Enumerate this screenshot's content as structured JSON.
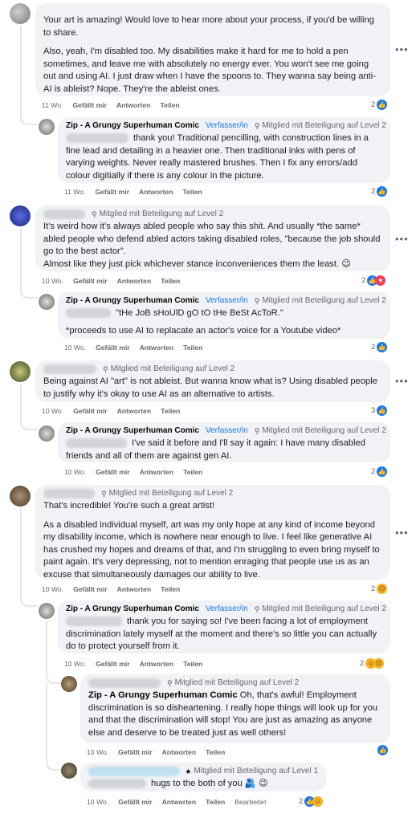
{
  "labels": {
    "like": "Gefällt mir",
    "reply": "Antworten",
    "share": "Teilen",
    "edited": "Bearbeitet",
    "author_tag": "Verfasser/in",
    "badge_level2": "Mitglied mit Beteiligung auf Level 2",
    "badge_level1": "Mitglied mit Beteiligung auf Level 1",
    "more": "•••"
  },
  "colors": {
    "accent": "#1877f2",
    "bubble": "#f0f2f5",
    "muted": "#65676b"
  },
  "comments": [
    {
      "author": "Zip - A Grungy Superhuman Comic",
      "texts": [
        "Your art is amazing! Would love to hear more about your process, if you'd be willing to share.",
        "Also, yeah, I'm disabled too. My disabilities make it hard for me to hold a pen sometimes, and leave me with absolutely no energy ever. You won't see me going out and using AI. I just draw when I have the spoons to. They wanna say being anti-AI is ableist? Nope. They're the ableist ones."
      ],
      "time": "11 Wo.",
      "reactions": "2"
    },
    {
      "author": "Zip - A Grungy Superhuman Comic",
      "text": "thank you! Traditional pencilling, with construction lines in a fine lead and detailing in a heavier one. Then traditional inks with pens of varying weights. Never really mastered brushes. Then I fix any errors/add colour digitially if there is any colour in the picture.",
      "time": "11 Wo.",
      "reactions": "2"
    },
    {
      "text": "It's weird how it's always abled people who say this shit. And usually *the same* abled people who defend abled actors taking disabled roles, \"because the job should go to the best actor\".\nAlmost like they just pick whichever stance inconveniences them the least. 😉",
      "time": "10 Wo.",
      "reactions": "2"
    },
    {
      "author": "Zip - A Grungy Superhuman Comic",
      "text1": "\"tHe JoB sHoUlD gO tO tHe BeSt AcToR.\"",
      "text2": "*proceeds to use AI to replacate an actor's voice for a Youtube video*",
      "time": "10 Wo.",
      "reactions": "2"
    },
    {
      "text": "Being against AI \"art\" is not ableist. But wanna know what is? Using disabled people to justify why it's okay to use AI as an alternative to artists.",
      "time": "10 Wo.",
      "reactions": "3"
    },
    {
      "author": "Zip - A Grungy Superhuman Comic",
      "text": "I've said it before and I'll say it again: I have many disabled friends and all of them are against gen AI.",
      "time": "10 Wo.",
      "reactions": "2"
    },
    {
      "texts": [
        "That's incredible! You're such a great artist!",
        "As a disabled individual myself, art was my only hope at any kind of income beyond my disability income, which is nowhere near enough to live. I feel like generative AI has crushed my hopes and dreams of that, and I'm struggling to even bring myself to paint again. It's very depressing, not to mention enraging that people use us as an excuse that simultaneously damages our ability to live."
      ],
      "time": "10 Wo.",
      "reactions": "2"
    },
    {
      "author": "Zip - A Grungy Superhuman Comic",
      "text": "thank you for saying so! I've been facing a lot of employment discrimination lately myself at the moment and there's so little you can actually do to protect yourself from it.",
      "time": "10 Wo.",
      "reactions": "2"
    },
    {
      "author": "Zip - A Grungy Superhuman Comic",
      "text": "Oh, that's awful! Employment discrimination is so disheartening. I really hope things will look up for you and that the discrimination will stop! You are just as amazing as anyone else and deserve to be treated just as well others!",
      "time": "10 Wo.",
      "reactions": ""
    },
    {
      "text": "hugs to the both of you 🫂 😉",
      "time": "10 Wo.",
      "reactions": "2"
    }
  ]
}
